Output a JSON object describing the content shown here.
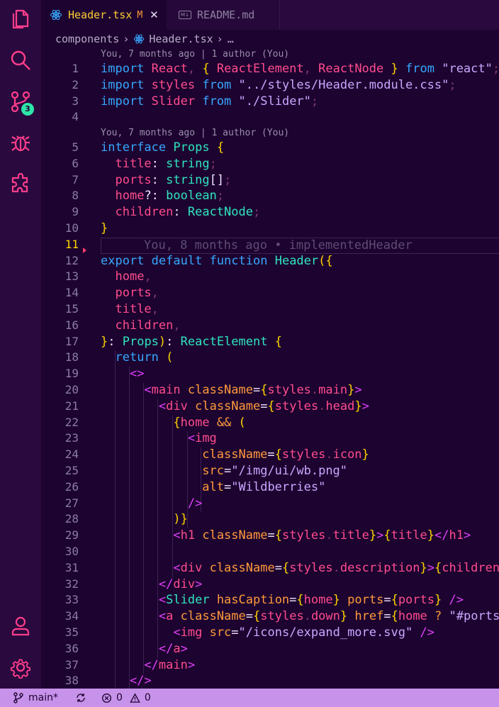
{
  "tabs": [
    {
      "label": "Header.tsx",
      "modified": "M",
      "active": true
    },
    {
      "label": "README.md",
      "active": false
    }
  ],
  "breadcrumb": {
    "folder": "components",
    "file": "Header.tsx",
    "more": "…"
  },
  "activity": {
    "source_control_badge": "3"
  },
  "codelens": [
    "You, 7 months ago | 1 author (You)",
    "You, 7 months ago | 1 author (You)"
  ],
  "blame_inline": "You, 8 months ago • implementedHeader",
  "current_line": 11,
  "code_lines": [
    {
      "n": 1,
      "tokens": [
        [
          "k",
          "import"
        ],
        [
          "w",
          " "
        ],
        [
          "n",
          "React"
        ],
        [
          "pu",
          ", "
        ],
        [
          "p",
          "{ "
        ],
        [
          "n",
          "ReactElement"
        ],
        [
          "pu",
          ", "
        ],
        [
          "n",
          "ReactNode"
        ],
        [
          "w",
          " "
        ],
        [
          "p",
          "}"
        ],
        [
          "w",
          " "
        ],
        [
          "k",
          "from"
        ],
        [
          "w",
          " "
        ],
        [
          "s",
          "\"react\""
        ],
        [
          "pu",
          ";"
        ]
      ]
    },
    {
      "n": 2,
      "tokens": [
        [
          "k",
          "import"
        ],
        [
          "w",
          " "
        ],
        [
          "n",
          "styles"
        ],
        [
          "w",
          " "
        ],
        [
          "k",
          "from"
        ],
        [
          "w",
          " "
        ],
        [
          "s",
          "\"../styles/Header.module.css\""
        ],
        [
          "pu",
          ";"
        ]
      ]
    },
    {
      "n": 3,
      "tokens": [
        [
          "k",
          "import"
        ],
        [
          "w",
          " "
        ],
        [
          "n",
          "Slider"
        ],
        [
          "w",
          " "
        ],
        [
          "k",
          "from"
        ],
        [
          "w",
          " "
        ],
        [
          "s",
          "\"./Slider\""
        ],
        [
          "pu",
          ";"
        ]
      ]
    },
    {
      "n": 4,
      "tokens": []
    },
    {
      "n": 5,
      "tokens": [
        [
          "k",
          "interface"
        ],
        [
          "w",
          " "
        ],
        [
          "t",
          "Props"
        ],
        [
          "w",
          " "
        ],
        [
          "p",
          "{"
        ]
      ]
    },
    {
      "n": 6,
      "tokens": [
        [
          "w",
          "  "
        ],
        [
          "n",
          "title"
        ],
        [
          "w",
          ": "
        ],
        [
          "t",
          "string"
        ],
        [
          "pu",
          ";"
        ]
      ]
    },
    {
      "n": 7,
      "tokens": [
        [
          "w",
          "  "
        ],
        [
          "n",
          "ports"
        ],
        [
          "w",
          ": "
        ],
        [
          "t",
          "string"
        ],
        [
          "w",
          "[]"
        ],
        [
          "pu",
          ";"
        ]
      ]
    },
    {
      "n": 8,
      "tokens": [
        [
          "w",
          "  "
        ],
        [
          "n",
          "home"
        ],
        [
          "w",
          "?: "
        ],
        [
          "t",
          "boolean"
        ],
        [
          "pu",
          ";"
        ]
      ]
    },
    {
      "n": 9,
      "tokens": [
        [
          "w",
          "  "
        ],
        [
          "n",
          "children"
        ],
        [
          "w",
          ": "
        ],
        [
          "t",
          "ReactNode"
        ],
        [
          "pu",
          ";"
        ]
      ]
    },
    {
      "n": 10,
      "tokens": [
        [
          "p",
          "}"
        ]
      ]
    },
    {
      "n": 11,
      "tokens": []
    },
    {
      "n": 12,
      "tokens": [
        [
          "k",
          "export"
        ],
        [
          "w",
          " "
        ],
        [
          "k",
          "default"
        ],
        [
          "w",
          " "
        ],
        [
          "k",
          "function"
        ],
        [
          "w",
          " "
        ],
        [
          "t",
          "Header"
        ],
        [
          "p",
          "({"
        ]
      ]
    },
    {
      "n": 13,
      "tokens": [
        [
          "w",
          "  "
        ],
        [
          "n",
          "home"
        ],
        [
          "pu",
          ","
        ]
      ]
    },
    {
      "n": 14,
      "tokens": [
        [
          "w",
          "  "
        ],
        [
          "n",
          "ports"
        ],
        [
          "pu",
          ","
        ]
      ]
    },
    {
      "n": 15,
      "tokens": [
        [
          "w",
          "  "
        ],
        [
          "n",
          "title"
        ],
        [
          "pu",
          ","
        ]
      ]
    },
    {
      "n": 16,
      "tokens": [
        [
          "w",
          "  "
        ],
        [
          "n",
          "children"
        ],
        [
          "pu",
          ","
        ]
      ]
    },
    {
      "n": 17,
      "tokens": [
        [
          "p",
          "}"
        ],
        [
          "w",
          ": "
        ],
        [
          "t",
          "Props"
        ],
        [
          "p",
          ")"
        ],
        [
          "w",
          ": "
        ],
        [
          "t",
          "ReactElement"
        ],
        [
          "w",
          " "
        ],
        [
          "p",
          "{"
        ]
      ]
    },
    {
      "n": 18,
      "tokens": [
        [
          "w",
          "  "
        ],
        [
          "k",
          "return"
        ],
        [
          "w",
          " "
        ],
        [
          "p",
          "("
        ]
      ]
    },
    {
      "n": 19,
      "tokens": [
        [
          "w",
          "    "
        ],
        [
          "tg",
          "<>"
        ]
      ]
    },
    {
      "n": 20,
      "tokens": [
        [
          "w",
          "      "
        ],
        [
          "tg",
          "<"
        ],
        [
          "n",
          "main"
        ],
        [
          "w",
          " "
        ],
        [
          "a",
          "className"
        ],
        [
          "w",
          "="
        ],
        [
          "p",
          "{"
        ],
        [
          "n",
          "styles"
        ],
        [
          "pu",
          "."
        ],
        [
          "n",
          "main"
        ],
        [
          "p",
          "}"
        ],
        [
          "tg",
          ">"
        ]
      ]
    },
    {
      "n": 21,
      "tokens": [
        [
          "w",
          "        "
        ],
        [
          "tg",
          "<"
        ],
        [
          "n",
          "div"
        ],
        [
          "w",
          " "
        ],
        [
          "a",
          "className"
        ],
        [
          "w",
          "="
        ],
        [
          "p",
          "{"
        ],
        [
          "n",
          "styles"
        ],
        [
          "pu",
          "."
        ],
        [
          "n",
          "head"
        ],
        [
          "p",
          "}"
        ],
        [
          "tg",
          ">"
        ]
      ]
    },
    {
      "n": 22,
      "tokens": [
        [
          "w",
          "          "
        ],
        [
          "p",
          "{"
        ],
        [
          "n",
          "home"
        ],
        [
          "w",
          " "
        ],
        [
          "a",
          "&&"
        ],
        [
          "w",
          " "
        ],
        [
          "p",
          "("
        ]
      ]
    },
    {
      "n": 23,
      "tokens": [
        [
          "w",
          "            "
        ],
        [
          "tg",
          "<"
        ],
        [
          "n",
          "img"
        ]
      ]
    },
    {
      "n": 24,
      "tokens": [
        [
          "w",
          "              "
        ],
        [
          "a",
          "className"
        ],
        [
          "w",
          "="
        ],
        [
          "p",
          "{"
        ],
        [
          "n",
          "styles"
        ],
        [
          "pu",
          "."
        ],
        [
          "n",
          "icon"
        ],
        [
          "p",
          "}"
        ]
      ]
    },
    {
      "n": 25,
      "tokens": [
        [
          "w",
          "              "
        ],
        [
          "a",
          "src"
        ],
        [
          "w",
          "="
        ],
        [
          "s",
          "\"/img/ui/wb.png\""
        ]
      ]
    },
    {
      "n": 26,
      "tokens": [
        [
          "w",
          "              "
        ],
        [
          "a",
          "alt"
        ],
        [
          "w",
          "="
        ],
        [
          "s",
          "\"Wildberries\""
        ]
      ]
    },
    {
      "n": 27,
      "tokens": [
        [
          "w",
          "            "
        ],
        [
          "tg",
          "/>"
        ]
      ]
    },
    {
      "n": 28,
      "tokens": [
        [
          "w",
          "          "
        ],
        [
          "p",
          ")}"
        ]
      ]
    },
    {
      "n": 29,
      "tokens": [
        [
          "w",
          "          "
        ],
        [
          "tg",
          "<"
        ],
        [
          "n",
          "h1"
        ],
        [
          "w",
          " "
        ],
        [
          "a",
          "className"
        ],
        [
          "w",
          "="
        ],
        [
          "p",
          "{"
        ],
        [
          "n",
          "styles"
        ],
        [
          "pu",
          "."
        ],
        [
          "n",
          "title"
        ],
        [
          "p",
          "}"
        ],
        [
          "tg",
          ">"
        ],
        [
          "p",
          "{"
        ],
        [
          "n",
          "title"
        ],
        [
          "p",
          "}"
        ],
        [
          "tg",
          "</"
        ],
        [
          "n",
          "h1"
        ],
        [
          "tg",
          ">"
        ]
      ]
    },
    {
      "n": 30,
      "tokens": []
    },
    {
      "n": 31,
      "tokens": [
        [
          "w",
          "          "
        ],
        [
          "tg",
          "<"
        ],
        [
          "n",
          "div"
        ],
        [
          "w",
          " "
        ],
        [
          "a",
          "className"
        ],
        [
          "w",
          "="
        ],
        [
          "p",
          "{"
        ],
        [
          "n",
          "styles"
        ],
        [
          "pu",
          "."
        ],
        [
          "n",
          "description"
        ],
        [
          "p",
          "}"
        ],
        [
          "tg",
          ">"
        ],
        [
          "p",
          "{"
        ],
        [
          "n",
          "children"
        ],
        [
          "p",
          "}"
        ]
      ]
    },
    {
      "n": 32,
      "tokens": [
        [
          "w",
          "        "
        ],
        [
          "tg",
          "</"
        ],
        [
          "n",
          "div"
        ],
        [
          "tg",
          ">"
        ]
      ]
    },
    {
      "n": 33,
      "tokens": [
        [
          "w",
          "        "
        ],
        [
          "tg",
          "<"
        ],
        [
          "t",
          "Slider"
        ],
        [
          "w",
          " "
        ],
        [
          "a",
          "hasCaption"
        ],
        [
          "w",
          "="
        ],
        [
          "p",
          "{"
        ],
        [
          "n",
          "home"
        ],
        [
          "p",
          "}"
        ],
        [
          "w",
          " "
        ],
        [
          "a",
          "ports"
        ],
        [
          "w",
          "="
        ],
        [
          "p",
          "{"
        ],
        [
          "n",
          "ports"
        ],
        [
          "p",
          "}"
        ],
        [
          "w",
          " "
        ],
        [
          "tg",
          "/>"
        ]
      ]
    },
    {
      "n": 34,
      "tokens": [
        [
          "w",
          "        "
        ],
        [
          "tg",
          "<"
        ],
        [
          "n",
          "a"
        ],
        [
          "w",
          " "
        ],
        [
          "a",
          "className"
        ],
        [
          "w",
          "="
        ],
        [
          "p",
          "{"
        ],
        [
          "n",
          "styles"
        ],
        [
          "pu",
          "."
        ],
        [
          "n",
          "down"
        ],
        [
          "p",
          "}"
        ],
        [
          "w",
          " "
        ],
        [
          "a",
          "href"
        ],
        [
          "w",
          "="
        ],
        [
          "p",
          "{"
        ],
        [
          "n",
          "home"
        ],
        [
          "w",
          " "
        ],
        [
          "a",
          "?"
        ],
        [
          "w",
          " "
        ],
        [
          "s",
          "\"#ports\""
        ]
      ]
    },
    {
      "n": 35,
      "tokens": [
        [
          "w",
          "          "
        ],
        [
          "tg",
          "<"
        ],
        [
          "n",
          "img"
        ],
        [
          "w",
          " "
        ],
        [
          "a",
          "src"
        ],
        [
          "w",
          "="
        ],
        [
          "s",
          "\"/icons/expand_more.svg\""
        ],
        [
          "w",
          " "
        ],
        [
          "tg",
          "/>"
        ]
      ]
    },
    {
      "n": 36,
      "tokens": [
        [
          "w",
          "        "
        ],
        [
          "tg",
          "</"
        ],
        [
          "n",
          "a"
        ],
        [
          "tg",
          ">"
        ]
      ]
    },
    {
      "n": 37,
      "tokens": [
        [
          "w",
          "      "
        ],
        [
          "tg",
          "</"
        ],
        [
          "n",
          "main"
        ],
        [
          "tg",
          ">"
        ]
      ]
    },
    {
      "n": 38,
      "tokens": [
        [
          "w",
          "    "
        ],
        [
          "tg",
          "</>"
        ]
      ]
    }
  ],
  "status": {
    "branch": "main*",
    "errors": "0",
    "warnings": "0"
  },
  "colors": {
    "background": "#1d0330",
    "accent": "#ff3d8b",
    "status_bar": "#c792ea",
    "badge": "#2ee6a8"
  }
}
